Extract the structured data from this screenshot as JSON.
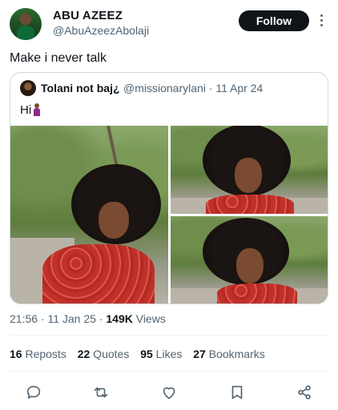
{
  "author": {
    "name": "ABU AZEEZ",
    "handle": "@AbuAzeezAbolaji"
  },
  "follow_label": "Follow",
  "tweet": {
    "text": "Make i never talk"
  },
  "quoted": {
    "name": "Tolani not baj¿",
    "meta": "@missionarylani · 11 Apr 24",
    "text": "Hi",
    "emoji_icon": "woman-standing-icon"
  },
  "timestamp": {
    "time_date": "21:56 · 11 Jan 25 · ",
    "views_count": "149K",
    "views_label": " Views"
  },
  "stats": {
    "reposts_count": "16",
    "reposts_label": " Reposts",
    "quotes_count": "22",
    "quotes_label": " Quotes",
    "likes_count": "95",
    "likes_label": " Likes",
    "bookmarks_count": "27",
    "bookmarks_label": " Bookmarks"
  },
  "actions": [
    "reply-icon",
    "repost-icon",
    "like-icon",
    "bookmark-icon",
    "share-icon"
  ],
  "colors": {
    "text_primary": "#0f1419",
    "text_secondary": "#536471",
    "follow_bg": "#0f1419",
    "border": "#cfd9de"
  }
}
